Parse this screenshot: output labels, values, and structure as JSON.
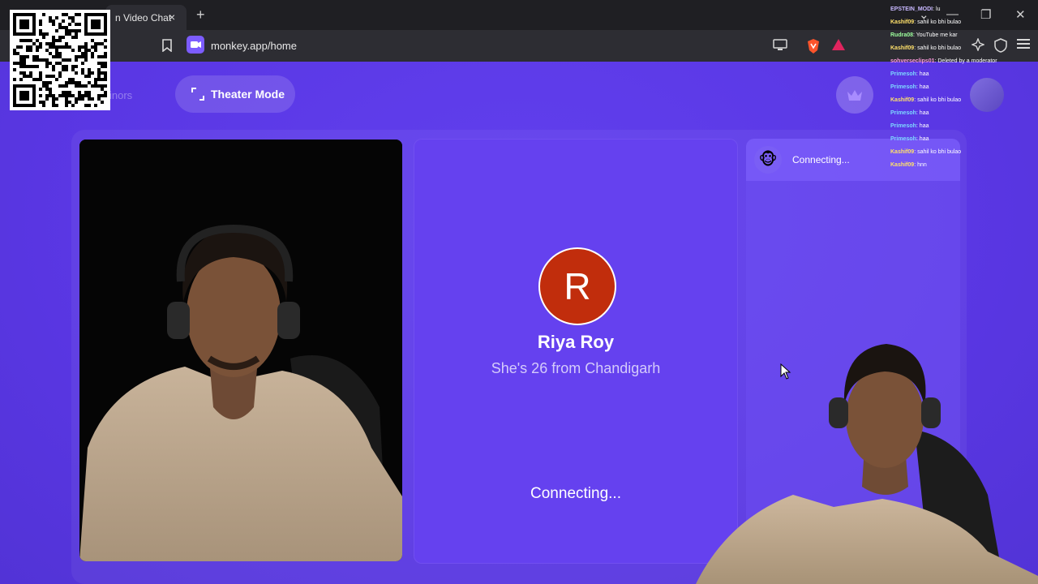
{
  "browser": {
    "tab_title": "n Video Chat",
    "tab_close": "×",
    "new_tab": "+",
    "url": "monkey.app/home",
    "window_controls": [
      "⌄",
      "—",
      "❐",
      "✕"
    ]
  },
  "page": {
    "minors_text": "inors",
    "theater_label": "Theater Mode",
    "match": {
      "initial": "R",
      "name": "Riya Roy",
      "subtitle": "She's 26 from Chandigarh",
      "status": "Connecting..."
    },
    "chat": {
      "status": "Connecting..."
    },
    "colors": {
      "background": "#5b3be0",
      "avatar": "#c12d0c"
    }
  },
  "stream_chat": [
    {
      "user": "EPSTEIN_MODI",
      "text": "lu",
      "color": "#c8b8ff"
    },
    {
      "user": "Kashif09",
      "text": "sahil ko bhi bulao",
      "color": "#ffe16b"
    },
    {
      "user": "Rudra08",
      "text": "YouTube me kar",
      "color": "#9dff9d"
    },
    {
      "user": "Kashif09",
      "text": "sahil ko bhi bulao",
      "color": "#ffe16b"
    },
    {
      "user": "sohverseclips01",
      "text": "Deleted by a moderator",
      "color": "#ff9be0"
    },
    {
      "user": "Primesoh",
      "text": "haa",
      "color": "#7dd8ff"
    },
    {
      "user": "Primesoh",
      "text": "haa",
      "color": "#7dd8ff"
    },
    {
      "user": "Kashif09",
      "text": "sahil ko bhi bulao",
      "color": "#ffe16b"
    },
    {
      "user": "Primesoh",
      "text": "haa",
      "color": "#7dd8ff"
    },
    {
      "user": "Primesoh",
      "text": "haa",
      "color": "#7dd8ff"
    },
    {
      "user": "Primesoh",
      "text": "haa",
      "color": "#7dd8ff"
    },
    {
      "user": "Kashif09",
      "text": "sahil ko bhi bulao",
      "color": "#ffe16b"
    },
    {
      "user": "Kashif09",
      "text": "hnn",
      "color": "#ffe16b"
    }
  ]
}
